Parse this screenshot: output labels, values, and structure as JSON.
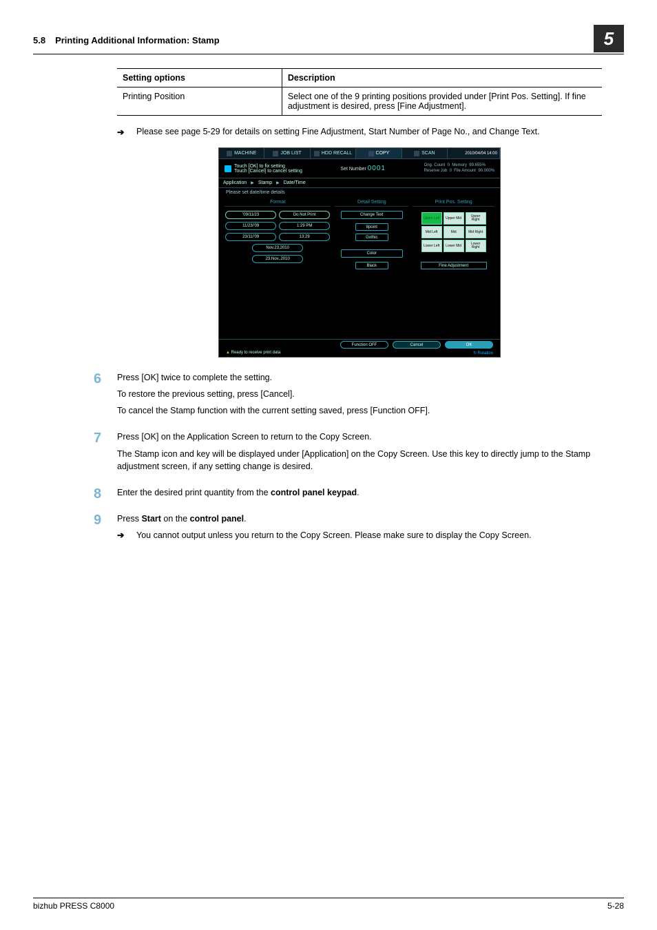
{
  "header": {
    "section_number": "5.8",
    "section_title": "Printing Additional Information: Stamp",
    "chapter": "5"
  },
  "table": {
    "col1": "Setting options",
    "col2": "Description",
    "row1col1": "Printing Position",
    "row1col2": "Select one of the 9 printing positions provided under [Print Pos. Setting]. If fine adjustment is desired, press [Fine Adjustment]."
  },
  "prenote": "Please see page 5-29 for details on setting Fine Adjustment, Start Number of Page No., and Change Text.",
  "touchpanel": {
    "tabs": {
      "machine": "MACHINE",
      "joblist": "JOB LIST",
      "recall": "HDD RECALL",
      "copy": "COPY",
      "scan": "SCAN"
    },
    "datetime": "2010/04/04 14:00",
    "info_line1": "Touch [OK] to fix setting",
    "info_line2": "Touch [Cancel] to cancel setting",
    "setnumber_label": "Set Number",
    "setnumber_value": "0001",
    "stats": {
      "orig": "Orig. Count",
      "orig_v": "0",
      "reserve": "Reserve Job",
      "reserve_v": "0",
      "mem": "Memory",
      "mem_v": "99.655%",
      "file": "File Amount",
      "file_v": "90.000%"
    },
    "bc": {
      "c1": "Application",
      "c2": "Stamp",
      "c3": "Date/Time"
    },
    "subhead": "Please set date/time details",
    "col_format": "Format",
    "col_detail": "Detail Setting",
    "col_pos": "Print Pos. Setting",
    "format": {
      "d1": "'09/11/23",
      "t1": "Do Not Print",
      "d2": "11/23/'09",
      "t2": "1:29 PM",
      "d3": "23/11/'09",
      "t3": "13:29",
      "d4": "Nov.23,2010",
      "d5": "23.Nov.,2010"
    },
    "detail": {
      "change": "Change Text",
      "sp": "8point",
      "gt": "Gothic",
      "color": "Color",
      "black": "Black"
    },
    "pos": {
      "g0": "Upper Left",
      "g1": "Upper Mid",
      "g2": "Upper Right",
      "g3": "Mid Left",
      "g4": "Mid",
      "g5": "Mid Right",
      "g6": "Lower Left",
      "g7": "Lower Mid",
      "g8": "Lower Right",
      "fine": "Fine Adjustment"
    },
    "footer": {
      "func": "Function OFF",
      "cancel": "Cancel",
      "ok": "OK",
      "ready": "Ready to receive print data",
      "rotation": "Rotation"
    }
  },
  "steps": {
    "s6n": "6",
    "s6a": "Press [OK] twice to complete the setting.",
    "s6b": "To restore the previous setting, press [Cancel].",
    "s6c": "To cancel the Stamp function with the current setting saved, press [Function OFF].",
    "s7n": "7",
    "s7a": "Press [OK] on the Application Screen to return to the Copy Screen.",
    "s7b": "The Stamp icon and key will be displayed under [Application] on the Copy Screen. Use this key to directly jump to the Stamp adjustment screen, if any setting change is desired.",
    "s8n": "8",
    "s8a_pre": "Enter the desired print quantity from the ",
    "s8a_b": "control panel keypad",
    "s8a_post": ".",
    "s9n": "9",
    "s9a_pre": "Press ",
    "s9a_b1": "Start",
    "s9a_mid": " on the ",
    "s9a_b2": "control panel",
    "s9a_post": ".",
    "s9b": "You cannot output unless you return to the Copy Screen. Please make sure to display the Copy Screen."
  },
  "footer": {
    "left": "bizhub PRESS C8000",
    "right": "5-28"
  },
  "arrow": "➔"
}
